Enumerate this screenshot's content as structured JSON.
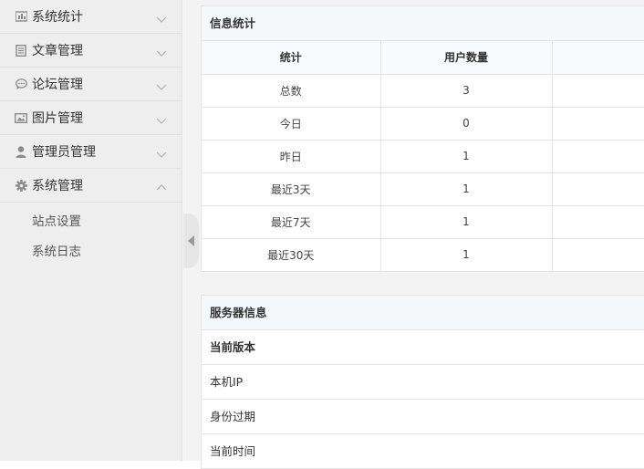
{
  "sidebar": {
    "items": [
      {
        "label": "系统统计",
        "icon": "stats-icon",
        "expanded": false
      },
      {
        "label": "文章管理",
        "icon": "article-icon",
        "expanded": false
      },
      {
        "label": "论坛管理",
        "icon": "chat-icon",
        "expanded": false
      },
      {
        "label": "图片管理",
        "icon": "image-icon",
        "expanded": false
      },
      {
        "label": "管理员管理",
        "icon": "user-icon",
        "expanded": false
      },
      {
        "label": "系统管理",
        "icon": "gear-icon",
        "expanded": true
      }
    ],
    "subitems": [
      {
        "label": "站点设置"
      },
      {
        "label": "系统日志"
      }
    ]
  },
  "stats_panel": {
    "title": "信息统计",
    "headers": [
      "统计",
      "用户数量",
      ""
    ],
    "rows": [
      {
        "label": "总数",
        "value": "3"
      },
      {
        "label": "今日",
        "value": "0"
      },
      {
        "label": "昨日",
        "value": "1"
      },
      {
        "label": "最近3天",
        "value": "1"
      },
      {
        "label": "最近7天",
        "value": "1"
      },
      {
        "label": "最近30天",
        "value": "1"
      }
    ]
  },
  "server_panel": {
    "title": "服务器信息",
    "rows": [
      {
        "label": "当前版本"
      },
      {
        "label": "本机IP"
      },
      {
        "label": "身份过期"
      },
      {
        "label": "当前时间"
      }
    ]
  },
  "colors": {
    "sidebar_bg": "#eeeeee",
    "panel_head_bg": "#f4f8fb",
    "border": "#e4e4e4",
    "icon": "#8a8a8a"
  }
}
